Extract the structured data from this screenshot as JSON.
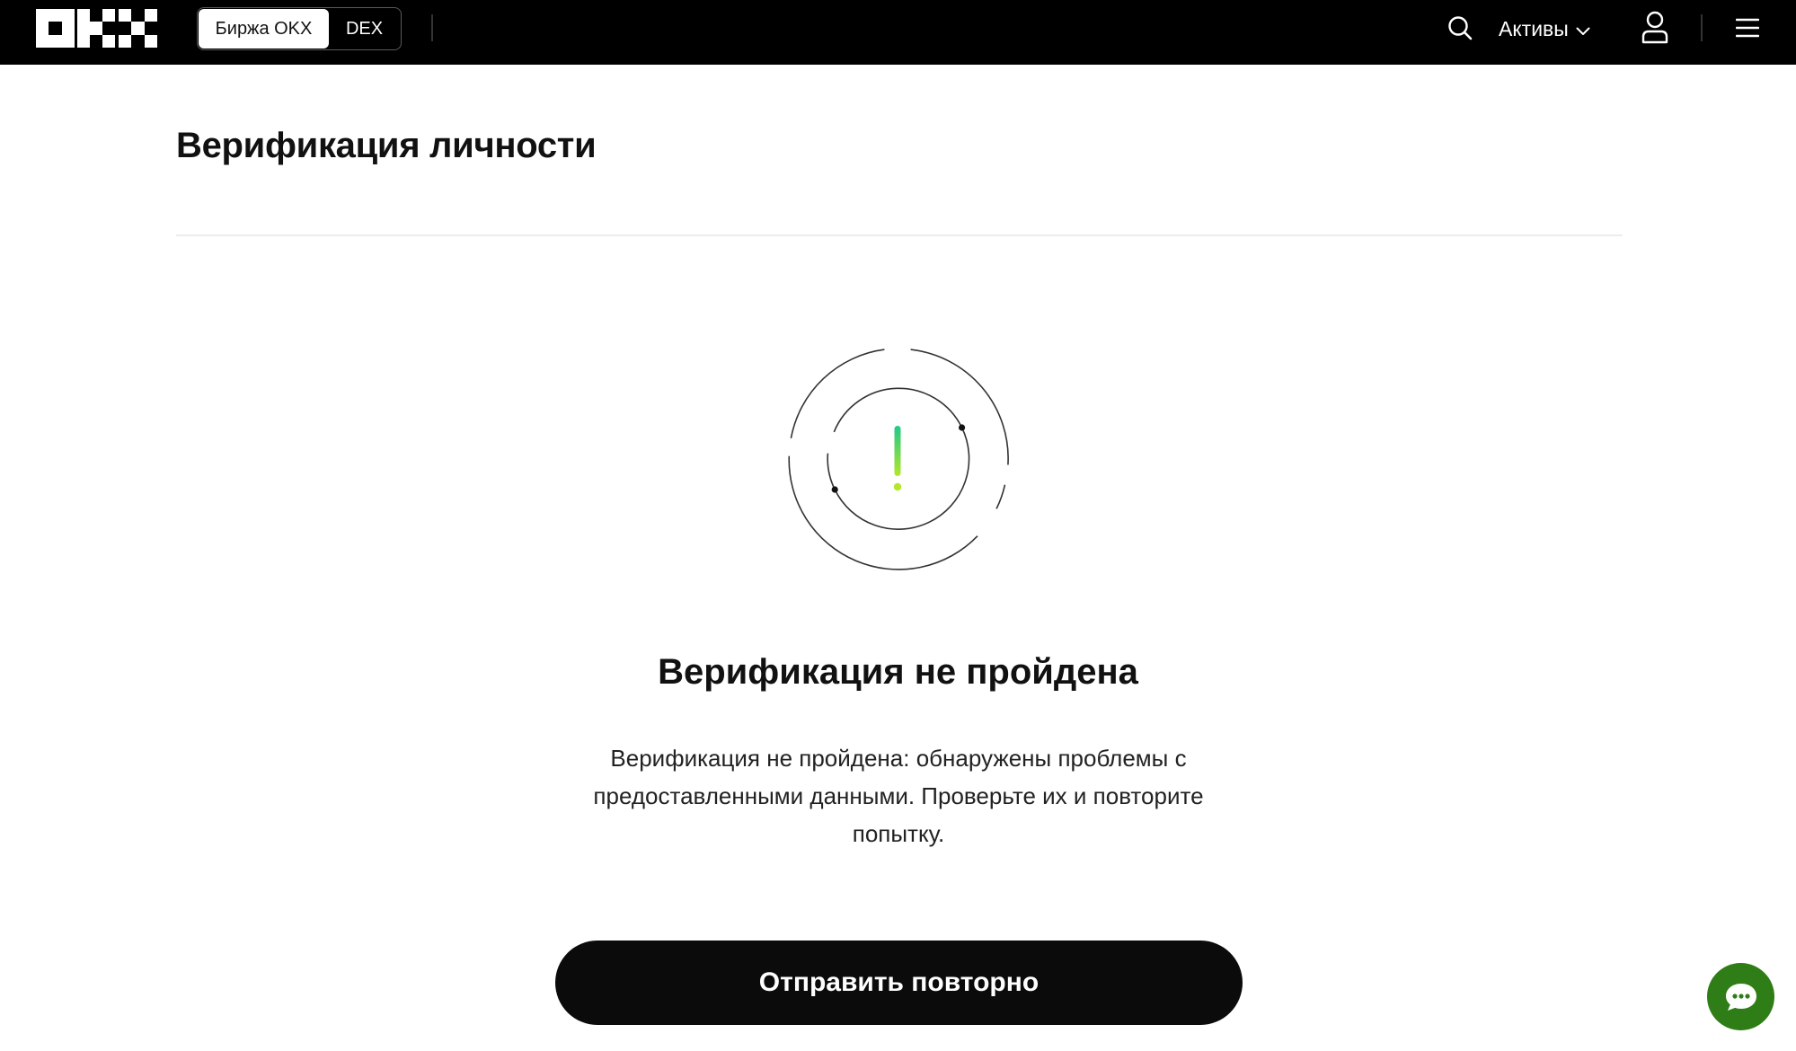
{
  "header": {
    "logo_text": "OKX",
    "tabs": [
      {
        "label": "Биржа OKX",
        "active": true
      },
      {
        "label": "DEX",
        "active": false
      }
    ],
    "assets_label": "Активы",
    "icons": {
      "search": "search-icon",
      "assets_dropdown": "chevron-down-icon",
      "user": "user-icon",
      "menu": "hamburger-menu-icon"
    }
  },
  "page": {
    "title": "Верификация личности"
  },
  "status": {
    "icon": "exclamation-circle-icon",
    "title": "Верификация не пройдена",
    "description": "Верификация не пройдена: обнаружены проблемы с предоставленными данными. Проверьте их и повторите попытку."
  },
  "actions": {
    "resend_label": "Отправить повторно"
  },
  "chat": {
    "icon": "chat-bubble-icon"
  },
  "colors": {
    "header_bg": "#000000",
    "accent_green": "#2f7d16",
    "exclamation_top": "#1fc98a",
    "exclamation_bottom": "#b4e62a",
    "button_bg": "#0b0b0b"
  }
}
